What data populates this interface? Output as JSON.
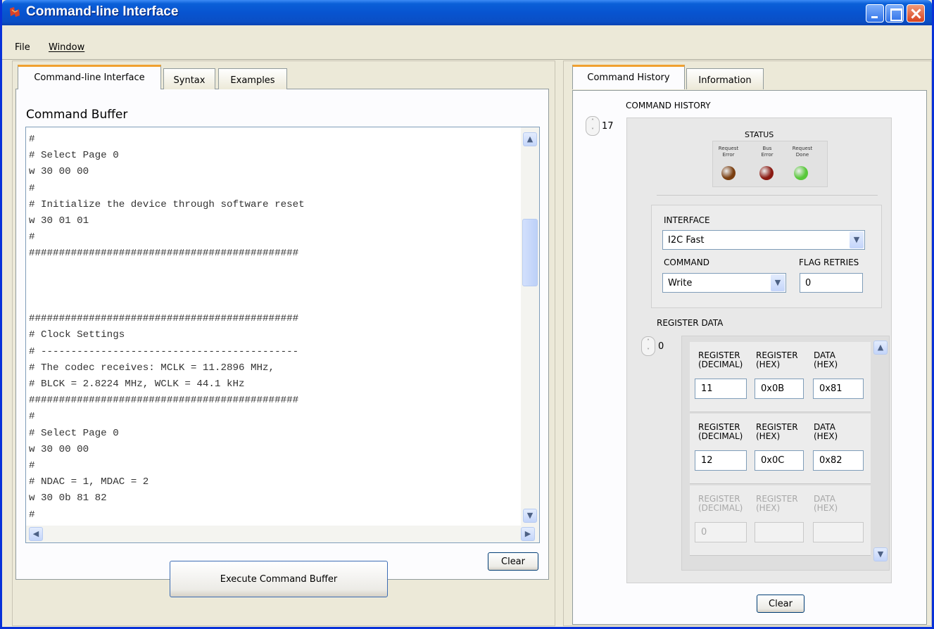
{
  "window": {
    "title": "Command-line Interface"
  },
  "menu": {
    "file": "File",
    "window": "Window"
  },
  "left_panel": {
    "tabs": [
      "Command-line Interface",
      "Syntax",
      "Examples"
    ],
    "buffer_title": "Command Buffer",
    "buffer_lines": [
      "#",
      "# Select Page 0",
      "w 30 00 00",
      "#",
      "# Initialize the device through software reset",
      "w 30 01 01",
      "#",
      "#############################################",
      "",
      "",
      "",
      "#############################################",
      "# Clock Settings",
      "# -------------------------------------------",
      "# The codec receives: MCLK = 11.2896 MHz,",
      "# BLCK = 2.8224 MHz, WCLK = 44.1 kHz",
      "#############################################",
      "#",
      "# Select Page 0",
      "w 30 00 00",
      "#",
      "# NDAC = 1, MDAC = 2",
      "w 30 0b 81 82",
      "#",
      "#############################################"
    ],
    "clear_label": "Clear",
    "execute_label": "Execute Command Buffer"
  },
  "right_panel": {
    "tabs": [
      "Command History",
      "Information"
    ],
    "history_title": "COMMAND HISTORY",
    "history_index": "17",
    "status": {
      "title": "STATUS",
      "leds": [
        {
          "label_1": "Request",
          "label_2": "Error",
          "color": "#7a3e10"
        },
        {
          "label_1": "Bus",
          "label_2": "Error",
          "color": "#8a1a12"
        },
        {
          "label_1": "Request",
          "label_2": "Done",
          "color": "#58c83a"
        }
      ]
    },
    "interface_label": "INTERFACE",
    "interface_value": "I2C Fast",
    "command_label": "COMMAND",
    "command_value": "Write",
    "flag_retries_label": "FLAG RETRIES",
    "flag_retries_value": "0",
    "register_data_title": "REGISTER DATA",
    "register_index": "0",
    "col_reg_dec": "REGISTER\n(DECIMAL)",
    "col_reg_hex": "REGISTER\n(HEX)",
    "col_data_hex": "DATA\n(HEX)",
    "registers": [
      {
        "dec": "11",
        "hex": "0x0B",
        "data": "0x81"
      },
      {
        "dec": "12",
        "hex": "0x0C",
        "data": "0x82"
      },
      {
        "dec": "0",
        "hex": "",
        "data": ""
      }
    ],
    "clear_label": "Clear"
  }
}
